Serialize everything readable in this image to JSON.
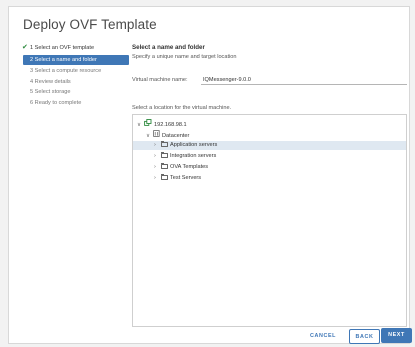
{
  "dialog": {
    "title": "Deploy OVF Template"
  },
  "steps": [
    {
      "label": "1 Select an OVF template",
      "state": "done"
    },
    {
      "label": "2 Select a name and folder",
      "state": "active"
    },
    {
      "label": "3 Select a compute resource",
      "state": "pending"
    },
    {
      "label": "4 Review details",
      "state": "pending"
    },
    {
      "label": "5 Select storage",
      "state": "pending"
    },
    {
      "label": "6 Ready to complete",
      "state": "pending"
    }
  ],
  "content": {
    "heading": "Select a name and folder",
    "subheading": "Specify a unique name and target location",
    "vm_name_label": "Virtual machine name:",
    "vm_name_value": "IQMessenger-9.0.0",
    "location_label": "Select a location for the virtual machine."
  },
  "tree": {
    "root": "192.168.98.1",
    "datacenter": "Datacenter",
    "folders": [
      "Application servers",
      "Integration servers",
      "OVA Templates",
      "Test Servers"
    ],
    "selected_index": 0
  },
  "buttons": {
    "cancel": "CANCEL",
    "back": "BACK",
    "next": "NEXT"
  },
  "colors": {
    "accent": "#3f77b6",
    "check": "#2d8a3e",
    "selected_row": "#dfe8f1"
  }
}
